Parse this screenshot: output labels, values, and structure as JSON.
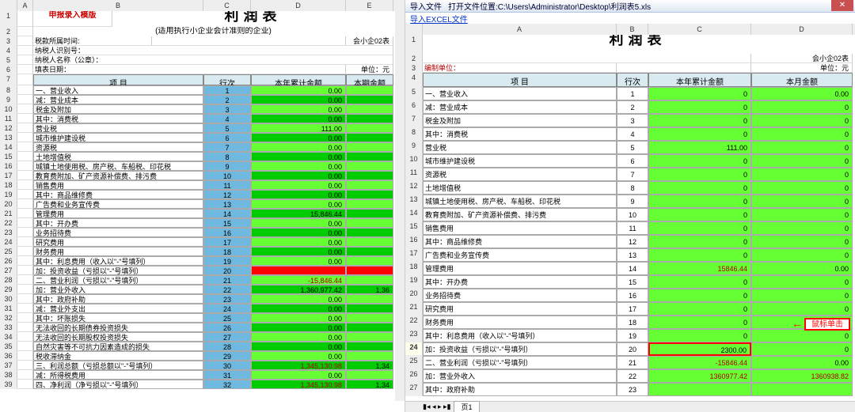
{
  "left": {
    "cols": [
      "A",
      "B",
      "C",
      "D",
      "E"
    ],
    "mergedTitle": "利润表",
    "redTemplate": "申报录入模版",
    "subtitle": "(适用执行小企业会计准则的企业)",
    "taxPeriodLabel": "税款所属时间:",
    "taxpayerIdLabel": "纳税人识别号：",
    "taxpayerNameLabel": "纳税人名称（公章）：",
    "fillDateLabel": "填表日期：",
    "formCode": "会小企02表",
    "unit": "单位：元",
    "headers": [
      "项 目",
      "行次",
      "本年累计金额",
      "本期金额"
    ],
    "rows": [
      {
        "n": 8,
        "item": "一、营业收入",
        "line": "1",
        "cum": "0.00",
        "cur": "",
        "cls": "lime"
      },
      {
        "n": 9,
        "item": "减：营业成本",
        "line": "2",
        "cum": "0.00",
        "cur": "",
        "cls": "green"
      },
      {
        "n": 10,
        "item": "    税金及附加",
        "line": "3",
        "cum": "0.00",
        "cur": "",
        "cls": "lime"
      },
      {
        "n": 11,
        "item": "    其中：消费税",
        "line": "4",
        "cum": "0.00",
        "cur": "",
        "cls": "green"
      },
      {
        "n": 12,
        "item": "        营业税",
        "line": "5",
        "cum": "111.00",
        "cur": "",
        "cls": "lime"
      },
      {
        "n": 13,
        "item": "        城市维护建设税",
        "line": "6",
        "cum": "0.00",
        "cur": "",
        "cls": "green"
      },
      {
        "n": 14,
        "item": "        资源税",
        "line": "7",
        "cum": "0.00",
        "cur": "",
        "cls": "lime"
      },
      {
        "n": 15,
        "item": "        土地增值税",
        "line": "8",
        "cum": "0.00",
        "cur": "",
        "cls": "green"
      },
      {
        "n": 16,
        "item": "        城镇土地使用税、房产税、车船税、印花税",
        "line": "9",
        "cum": "0.00",
        "cur": "",
        "cls": "lime"
      },
      {
        "n": 17,
        "item": "        教育费附加、矿产资源补偿费、排污费",
        "line": "10",
        "cum": "0.00",
        "cur": "",
        "cls": "green"
      },
      {
        "n": 18,
        "item": "    销售费用",
        "line": "11",
        "cum": "0.00",
        "cur": "",
        "cls": "lime"
      },
      {
        "n": 19,
        "item": "    其中：商品维修费",
        "line": "12",
        "cum": "0.00",
        "cur": "",
        "cls": "green"
      },
      {
        "n": 20,
        "item": "        广告费和业务宣传费",
        "line": "13",
        "cum": "0.00",
        "cur": "",
        "cls": "lime"
      },
      {
        "n": 21,
        "item": "    管理费用",
        "line": "14",
        "cum": "15,846.44",
        "cur": "",
        "cls": "green"
      },
      {
        "n": 22,
        "item": "    其中：开办费",
        "line": "15",
        "cum": "0.00",
        "cur": "",
        "cls": "lime"
      },
      {
        "n": 23,
        "item": "        业务招待费",
        "line": "16",
        "cum": "0.00",
        "cur": "",
        "cls": "green"
      },
      {
        "n": 24,
        "item": "        研究费用",
        "line": "17",
        "cum": "0.00",
        "cur": "",
        "cls": "lime"
      },
      {
        "n": 25,
        "item": "    财务费用",
        "line": "18",
        "cum": "0.00",
        "cur": "",
        "cls": "green"
      },
      {
        "n": 26,
        "item": "    其中：利息费用（收入以\"-\"号填列）",
        "line": "19",
        "cum": "0.00",
        "cur": "",
        "cls": "lime"
      },
      {
        "n": 27,
        "item": "加：投资收益（亏损以\"-\"号填列）",
        "line": "20",
        "cum": "",
        "cur": "",
        "cls": "red"
      },
      {
        "n": 28,
        "item": "二、营业利润（亏损以\"-\"号填列）",
        "line": "21",
        "cum": "-15,846.44",
        "cur": "",
        "cls": "lime",
        "neg": true
      },
      {
        "n": 29,
        "item": "加：营业外收入",
        "line": "22",
        "cum": "1,360,977.42",
        "cur": "1,36",
        "cls": "green"
      },
      {
        "n": 30,
        "item": "    其中：政府补助",
        "line": "23",
        "cum": "0.00",
        "cur": "",
        "cls": "lime"
      },
      {
        "n": 31,
        "item": "减：营业外支出",
        "line": "24",
        "cum": "0.00",
        "cur": "",
        "cls": "green"
      },
      {
        "n": 32,
        "item": "    其中：坏账损失",
        "line": "25",
        "cum": "0.00",
        "cur": "",
        "cls": "lime"
      },
      {
        "n": 33,
        "item": "        无法收回的长期债券投资损失",
        "line": "26",
        "cum": "0.00",
        "cur": "",
        "cls": "green"
      },
      {
        "n": 34,
        "item": "        无法收回的长期股权投资损失",
        "line": "27",
        "cum": "0.00",
        "cur": "",
        "cls": "lime"
      },
      {
        "n": 35,
        "item": "        自然灾害等不可抗力因素造成的损失",
        "line": "28",
        "cum": "0.00",
        "cur": "",
        "cls": "green"
      },
      {
        "n": 36,
        "item": "        税收滞纳金",
        "line": "29",
        "cum": "0.00",
        "cur": "",
        "cls": "lime"
      },
      {
        "n": 37,
        "item": "三、利润总额（亏损总额以\"-\"号填列）",
        "line": "30",
        "cum": "1,345,130.98",
        "cur": "1,34",
        "cls": "green",
        "neg": true
      },
      {
        "n": 38,
        "item": "减：所得税费用",
        "line": "31",
        "cum": "0.00",
        "cur": "",
        "cls": "lime"
      },
      {
        "n": 39,
        "item": "四、净利润（净亏损以\"-\"号填列）",
        "line": "32",
        "cum": "1,345,130.98",
        "cur": "1,34",
        "cls": "green",
        "neg": true
      }
    ]
  },
  "right": {
    "titlebarIcon": "导入文件",
    "titlebarPath": "打开文件位置:C:\\Users\\Administrator\\Desktop\\利润表5.xls",
    "importLink": "导入EXCEL文件",
    "cols": [
      "A",
      "B",
      "C",
      "D"
    ],
    "title": "利润表",
    "formCode": "会小企02表",
    "unitLabel": "编制单位：",
    "unit": "单位：元",
    "headers": [
      "项   目",
      "行次",
      "本年累计金额",
      "本月金额"
    ],
    "rows": [
      {
        "n": 5,
        "item": "一、营业收入",
        "line": "1",
        "cum": "0",
        "cur": "0.00"
      },
      {
        "n": 6,
        "item": "减：营业成本",
        "line": "2",
        "cum": "0",
        "cur": "0"
      },
      {
        "n": 7,
        "item": "    税金及附加",
        "line": "3",
        "cum": "0",
        "cur": "0"
      },
      {
        "n": 8,
        "item": "    其中：消费税",
        "line": "4",
        "cum": "0",
        "cur": "0"
      },
      {
        "n": 9,
        "item": "        营业税",
        "line": "5",
        "cum": "111.00",
        "cur": "0"
      },
      {
        "n": 10,
        "item": "        城市维护建设税",
        "line": "6",
        "cum": "0",
        "cur": "0"
      },
      {
        "n": 11,
        "item": "        资源税",
        "line": "7",
        "cum": "0",
        "cur": "0"
      },
      {
        "n": 12,
        "item": "        土地增值税",
        "line": "8",
        "cum": "0",
        "cur": "0"
      },
      {
        "n": 13,
        "item": "        城镇土地使用税、房产税、车船税、印花税",
        "line": "9",
        "cum": "0",
        "cur": "0"
      },
      {
        "n": 14,
        "item": "        教育费附加、矿产资源补偿费、排污费",
        "line": "10",
        "cum": "0",
        "cur": "0"
      },
      {
        "n": 15,
        "item": "    销售费用",
        "line": "11",
        "cum": "0",
        "cur": "0"
      },
      {
        "n": 16,
        "item": "    其中：商品维修费",
        "line": "12",
        "cum": "0",
        "cur": "0"
      },
      {
        "n": 17,
        "item": "        广告费和业务宣传费",
        "line": "13",
        "cum": "0",
        "cur": "0"
      },
      {
        "n": 18,
        "item": "    管理费用",
        "line": "14",
        "cum": "15846.44",
        "cur": "0.00",
        "neg": false,
        "cumcolor": "#b00000"
      },
      {
        "n": 19,
        "item": "    其中：开办费",
        "line": "15",
        "cum": "0",
        "cur": "0"
      },
      {
        "n": 20,
        "item": "        业务招待费",
        "line": "16",
        "cum": "0",
        "cur": "0"
      },
      {
        "n": 21,
        "item": "        研究费用",
        "line": "17",
        "cum": "0",
        "cur": "0"
      },
      {
        "n": 22,
        "item": "    财务费用",
        "line": "18",
        "cum": "0",
        "cur": "0"
      },
      {
        "n": 23,
        "item": "    其中：利息费用（收入以\"-\"号填列）",
        "line": "19",
        "cum": "0",
        "cur": "0"
      },
      {
        "n": 24,
        "item": "加：投资收益（亏损以\"-\"号填列）",
        "line": "20",
        "cum": "2300.00",
        "cur": "0",
        "hl": true
      },
      {
        "n": 25,
        "item": "二、营业利润（亏损以\"-\"号填列）",
        "line": "21",
        "cum": "-15846.44",
        "cur": "0.00",
        "neg": true
      },
      {
        "n": 26,
        "item": "加：营业外收入",
        "line": "22",
        "cum": "1360977.42",
        "cur": "1360938.82",
        "cumcolor": "#b00000",
        "curcolor": "#b00000"
      },
      {
        "n": 27,
        "item": "    其中：政府补助",
        "line": "23",
        "cum": "",
        "cur": ""
      }
    ],
    "sheetTab": "页1",
    "annotation": "鼠标单击"
  }
}
